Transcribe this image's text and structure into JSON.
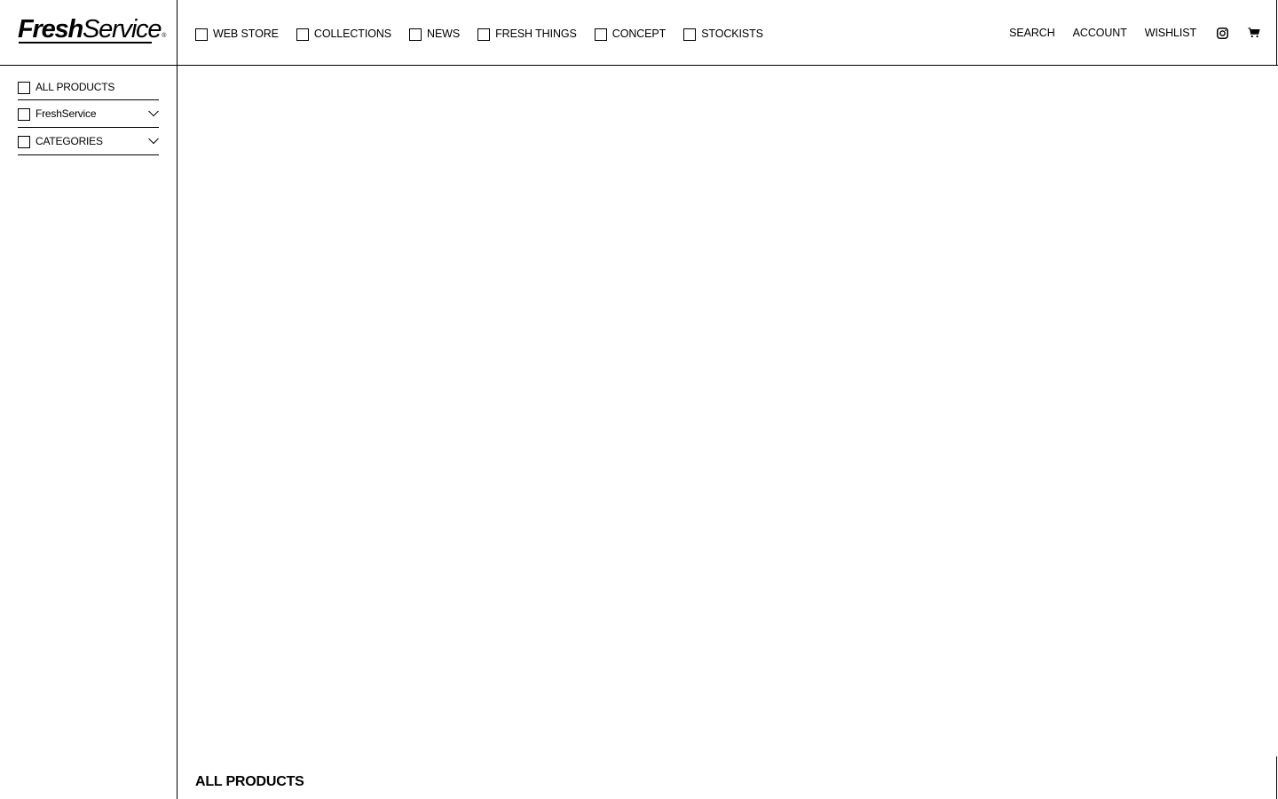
{
  "brand": {
    "logo_fresh": "Fresh",
    "logo_service": "Service",
    "logo_mark": "®"
  },
  "nav": {
    "items": [
      {
        "label": "WEB STORE"
      },
      {
        "label": "COLLECTIONS"
      },
      {
        "label": "NEWS"
      },
      {
        "label": "FRESH THINGS"
      },
      {
        "label": "CONCEPT"
      },
      {
        "label": "STOCKISTS"
      }
    ]
  },
  "utility": {
    "search": "SEARCH",
    "account": "ACCOUNT",
    "wishlist": "WISHLIST",
    "instagram_icon": "instagram-icon",
    "cart_icon": "cart-icon"
  },
  "sidebar": {
    "items": [
      {
        "label": "ALL PRODUCTS"
      },
      {
        "label": "FreshService"
      },
      {
        "label": "CATEGORIES"
      }
    ]
  },
  "main": {
    "title": "ALL PRODUCTS"
  },
  "colors": {
    "text": "#000000",
    "background": "#ffffff",
    "border": "#000000"
  }
}
